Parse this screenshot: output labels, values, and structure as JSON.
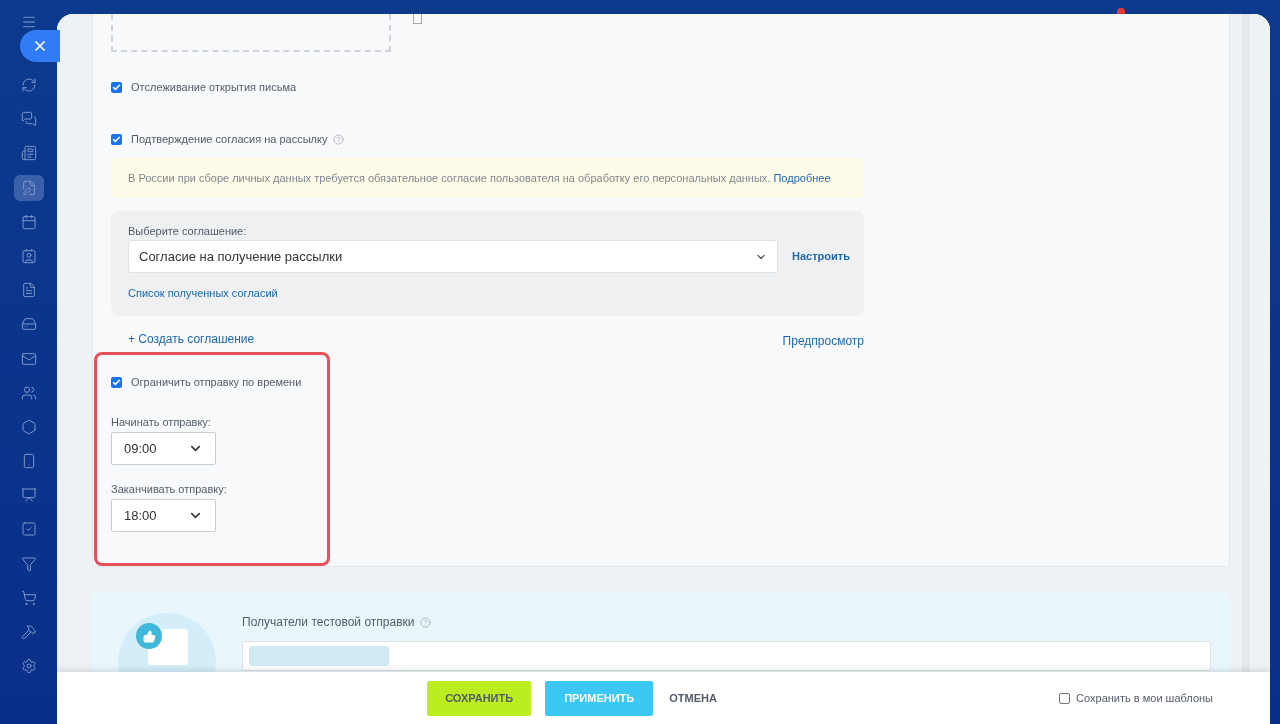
{
  "sidebar": {
    "items": [
      {
        "selected": false
      },
      {
        "selected": false
      },
      {
        "selected": false
      },
      {
        "selected": true
      },
      {
        "selected": false
      },
      {
        "selected": false
      },
      {
        "selected": false
      },
      {
        "selected": false
      },
      {
        "selected": false
      },
      {
        "selected": false
      },
      {
        "selected": false
      },
      {
        "selected": false
      },
      {
        "selected": false
      },
      {
        "selected": false
      },
      {
        "selected": false
      },
      {
        "selected": false
      },
      {
        "selected": false
      },
      {
        "selected": false
      }
    ]
  },
  "settings": {
    "track_open": {
      "label": "Отслеживание открытия письма",
      "checked": true
    },
    "consent": {
      "label": "Подтверждение согласия на рассылку",
      "checked": true
    },
    "notice": {
      "text": "В России при сборе личных данных требуется обязательное согласие пользователя на обработку его персональных данных.",
      "link": "Подробнее"
    },
    "agreement": {
      "label": "Выберите соглашение:",
      "value": "Согласие на получение рассылки",
      "configure": "Настроить",
      "list_link": "Список полученных согласий"
    },
    "create_link": "+ Создать соглашение",
    "preview_link": "Предпросмотр",
    "time_limit": {
      "label": "Ограничить отправку по времени",
      "checked": true,
      "start_label": "Начинать отправку:",
      "start": "09:00",
      "end_label": "Заканчивать отправку:",
      "end": "18:00"
    }
  },
  "test_send": {
    "label": "Получатели тестовой отправки"
  },
  "footer": {
    "save": "СОХРАНИТЬ",
    "apply": "ПРИМЕНИТЬ",
    "cancel": "ОТМЕНА",
    "template": {
      "label": "Сохранить в мои шаблоны",
      "checked": false
    }
  }
}
